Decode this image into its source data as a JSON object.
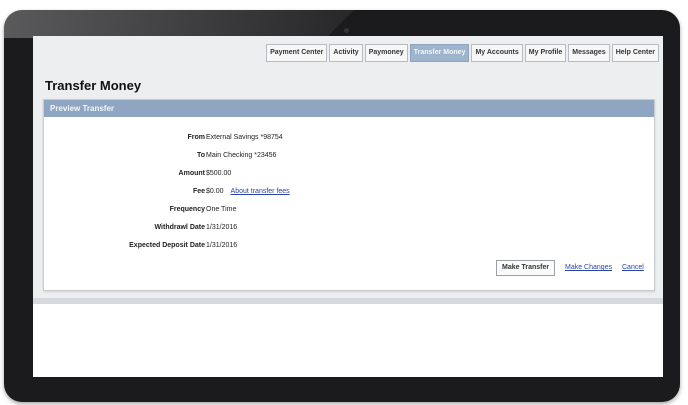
{
  "nav": {
    "tabs": [
      {
        "label": "Payment Center"
      },
      {
        "label": "Activity"
      },
      {
        "label": "Paymoney"
      },
      {
        "label": "Transfer Money"
      },
      {
        "label": "My Accounts"
      },
      {
        "label": "My Profile"
      },
      {
        "label": "Messages"
      },
      {
        "label": "Help Center"
      }
    ]
  },
  "page": {
    "title": "Transfer Money"
  },
  "panel": {
    "header": "Preview Transfer"
  },
  "details": {
    "from": {
      "label": "From",
      "value": "External Savings *98754"
    },
    "to": {
      "label": "To",
      "value": "Main Checking *23456"
    },
    "amount": {
      "label": "Amount",
      "value": "$500.00"
    },
    "fee": {
      "label": "Fee",
      "value": "$0.00",
      "link": "About transfer fees"
    },
    "frequency": {
      "label": "Frequency",
      "value": "One Time"
    },
    "withdrawal": {
      "label": "Withdrawl Date",
      "value": "1/31/2016"
    },
    "deposit": {
      "label": "Expected Deposit Date",
      "value": "1/31/2016"
    }
  },
  "actions": {
    "make_transfer": "Make Transfer",
    "make_changes": "Make Changes",
    "cancel": "Cancel"
  }
}
